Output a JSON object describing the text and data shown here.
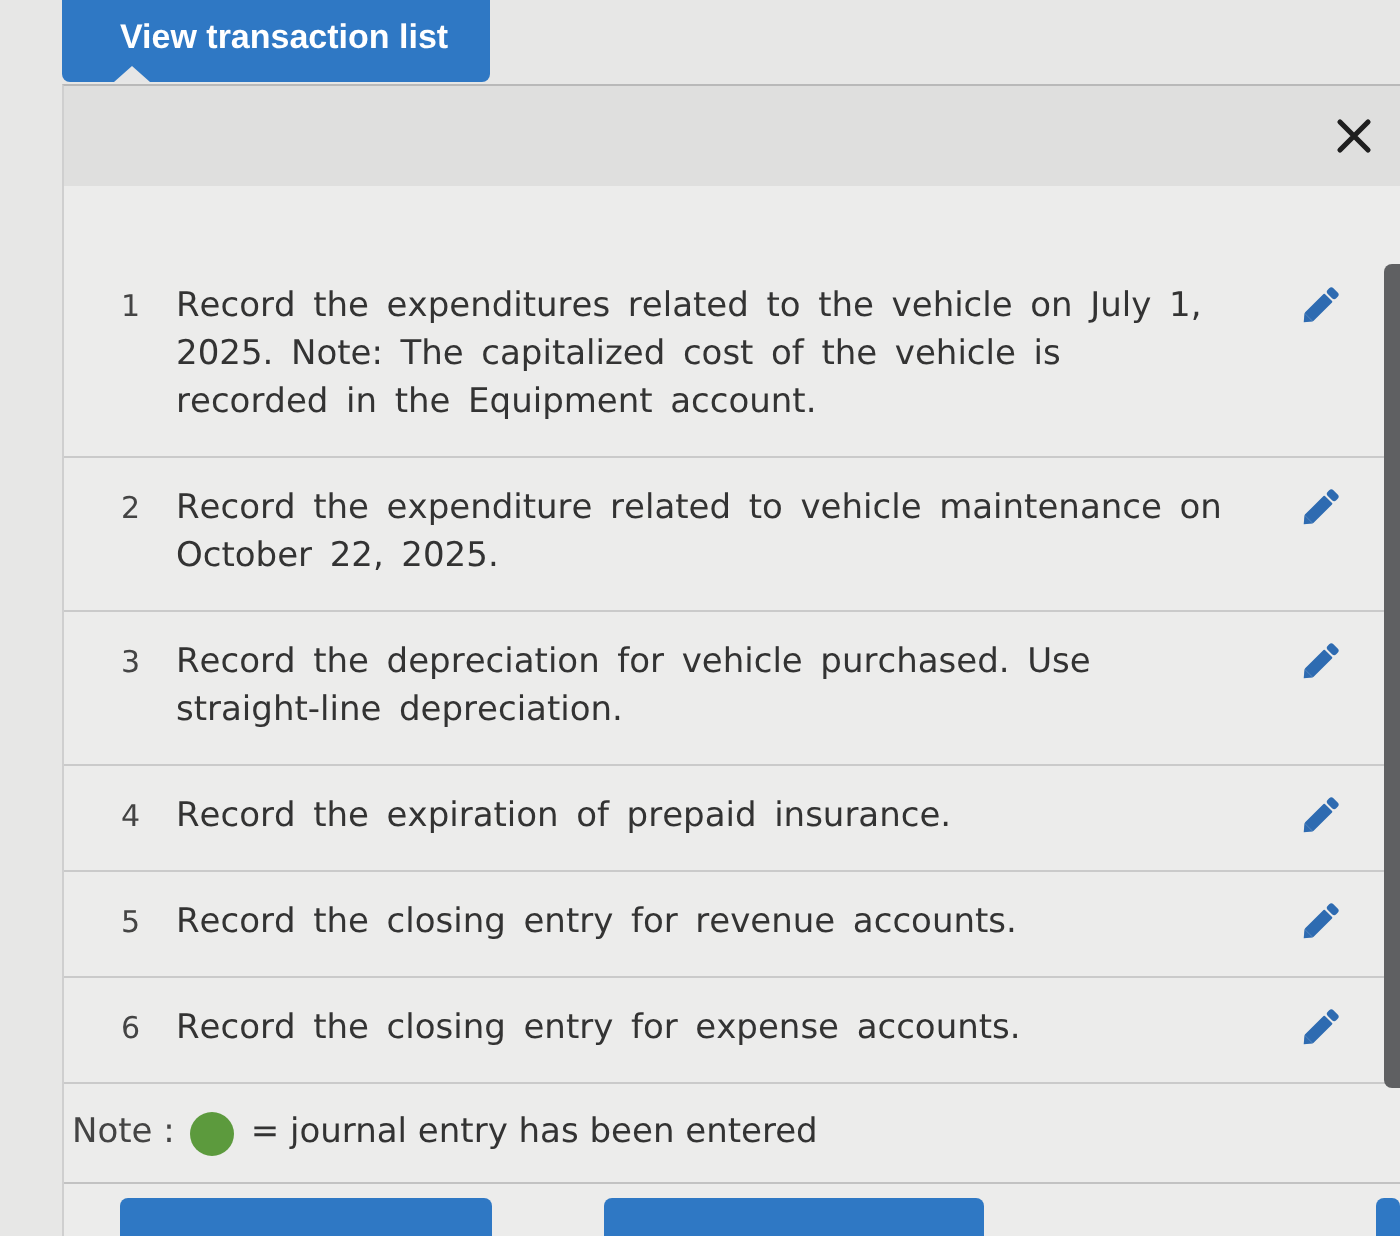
{
  "tab": {
    "label": "View transaction list",
    "selected": true
  },
  "transactions": [
    {
      "number": "1",
      "text": "Record the expenditures related to the vehicle on July 1, 2025. Note: The capitalized cost of the vehicle is recorded in the Equipment account."
    },
    {
      "number": "2",
      "text": "Record the expenditure related to vehicle maintenance on October 22, 2025."
    },
    {
      "number": "3",
      "text": "Record the depreciation for vehicle purchased. Use straight-line depreciation."
    },
    {
      "number": "4",
      "text": "Record the expiration of prepaid insurance."
    },
    {
      "number": "5",
      "text": "Record the closing entry for revenue accounts."
    },
    {
      "number": "6",
      "text": "Record the closing entry for expense accounts."
    }
  ],
  "note": {
    "label": "Note :",
    "text": "= journal entry has been entered"
  }
}
